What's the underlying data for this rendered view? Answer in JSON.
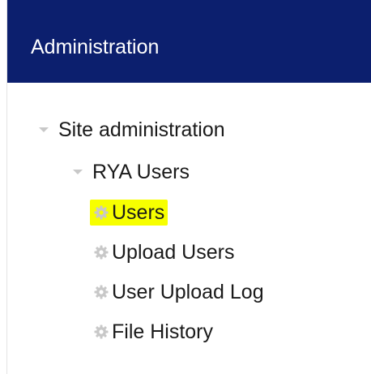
{
  "block": {
    "title": "Administration"
  },
  "tree": {
    "root": {
      "label": "Site administration",
      "expanded": true,
      "icon": "chevron-down-icon"
    },
    "branch": {
      "label": "RYA Users",
      "expanded": true,
      "icon": "chevron-down-icon"
    },
    "leaves": [
      {
        "label": "Users",
        "icon": "gear-icon",
        "highlighted": true
      },
      {
        "label": "Upload Users",
        "icon": "gear-icon",
        "highlighted": false
      },
      {
        "label": "User Upload Log",
        "icon": "gear-icon",
        "highlighted": false
      },
      {
        "label": "File History",
        "icon": "gear-icon",
        "highlighted": false
      }
    ]
  },
  "colors": {
    "header_bg": "#0c1f6e",
    "header_text": "#ffffff",
    "highlight": "#f7ff00",
    "icon": "#c8c8c8",
    "text": "#1a1a1a"
  }
}
